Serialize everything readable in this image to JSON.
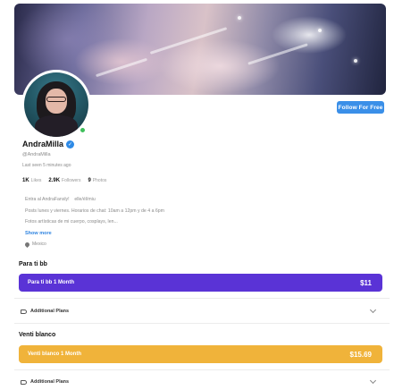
{
  "profile": {
    "name": "AndraMilla",
    "handle": "@AndraMilla",
    "last_seen": "Last seen 5 minutes ago",
    "follow_label": "Follow For Free",
    "stats": [
      {
        "value": "1K",
        "label": "Likes"
      },
      {
        "value": "2.9K",
        "label": "Followers"
      },
      {
        "value": "9",
        "label": "Photos"
      }
    ],
    "bio_lines": [
      "Entra al AndraFansly!    elle/él/miu",
      "Posts lunes y viernes. Horarios de chat: 10am a 12pm y de 4 a 6pm",
      "Fotos artísticas de mi cuerpo, cosplays, len..."
    ],
    "show_more": "Show more",
    "location": "Mexico",
    "verified_glyph": "✓"
  },
  "plans": [
    {
      "title": "Para ti bb",
      "bar_label": "Para ti bb 1 Month",
      "price": "$11",
      "color": "#5a33d6",
      "additional_label": "Additional Plans"
    },
    {
      "title": "Venti blanco",
      "bar_label": "Venti blanco 1 Month",
      "price": "$15.69",
      "color": "#f0b33a",
      "additional_label": "Additional Plans"
    }
  ],
  "colors": {
    "accent_blue": "#3a8fe8",
    "online_green": "#3fbf5c"
  }
}
